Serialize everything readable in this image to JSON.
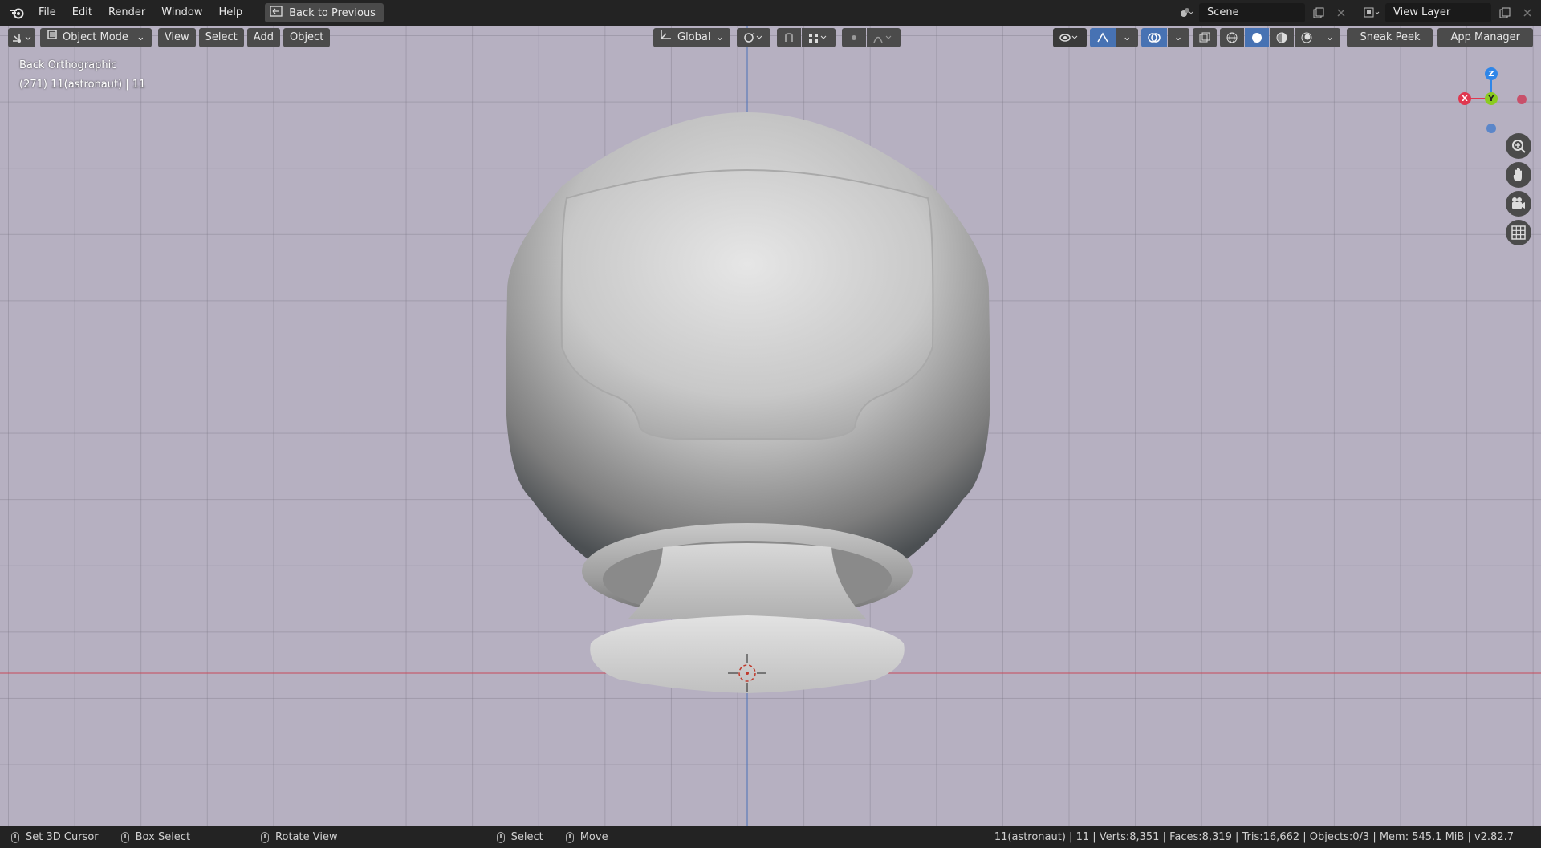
{
  "menu": {
    "file": "File",
    "edit": "Edit",
    "render": "Render",
    "window": "Window",
    "help": "Help",
    "back": "Back to Previous"
  },
  "topbar_right": {
    "scene": "Scene",
    "view_layer": "View Layer"
  },
  "header": {
    "mode": "Object Mode",
    "view": "View",
    "select": "Select",
    "add": "Add",
    "object": "Object",
    "orientation": "Global",
    "sneak_peek": "Sneak Peek",
    "app_manager": "App Manager"
  },
  "viewport": {
    "view_name": "Back Orthographic",
    "object_info": "(271) 11(astronaut) | 11",
    "axis_x": "X",
    "axis_y": "Y",
    "axis_z": "Z"
  },
  "status": {
    "set_cursor": "Set 3D Cursor",
    "box_select": "Box Select",
    "rotate": "Rotate View",
    "select": "Select",
    "move": "Move",
    "stats": "11(astronaut) | 11 | Verts:8,351 | Faces:8,319 | Tris:16,662 | Objects:0/3 | Mem: 545.1 MiB | v2.82.7"
  },
  "colors": {
    "viewport_bg": "#b6b0c1",
    "header_btn": "#4b4b4b",
    "active_blue": "#4772b3",
    "axis_x": "#e0374f",
    "axis_y": "#8bcc1f",
    "axis_z": "#2f86e8"
  },
  "icons": [
    "blender-logo",
    "editor-type-icon",
    "object-mode-icon",
    "orientation-icon",
    "pivot-icon",
    "snap-icon",
    "proportional-icon",
    "visibility-icon",
    "gizmo-icon",
    "overlay-icon",
    "xray-icon",
    "shading-wire-icon",
    "shading-solid-icon",
    "shading-material-icon",
    "shading-rendered-icon",
    "zoom-icon",
    "pan-hand-icon",
    "camera-icon",
    "grid-icon",
    "mouse-icon"
  ]
}
